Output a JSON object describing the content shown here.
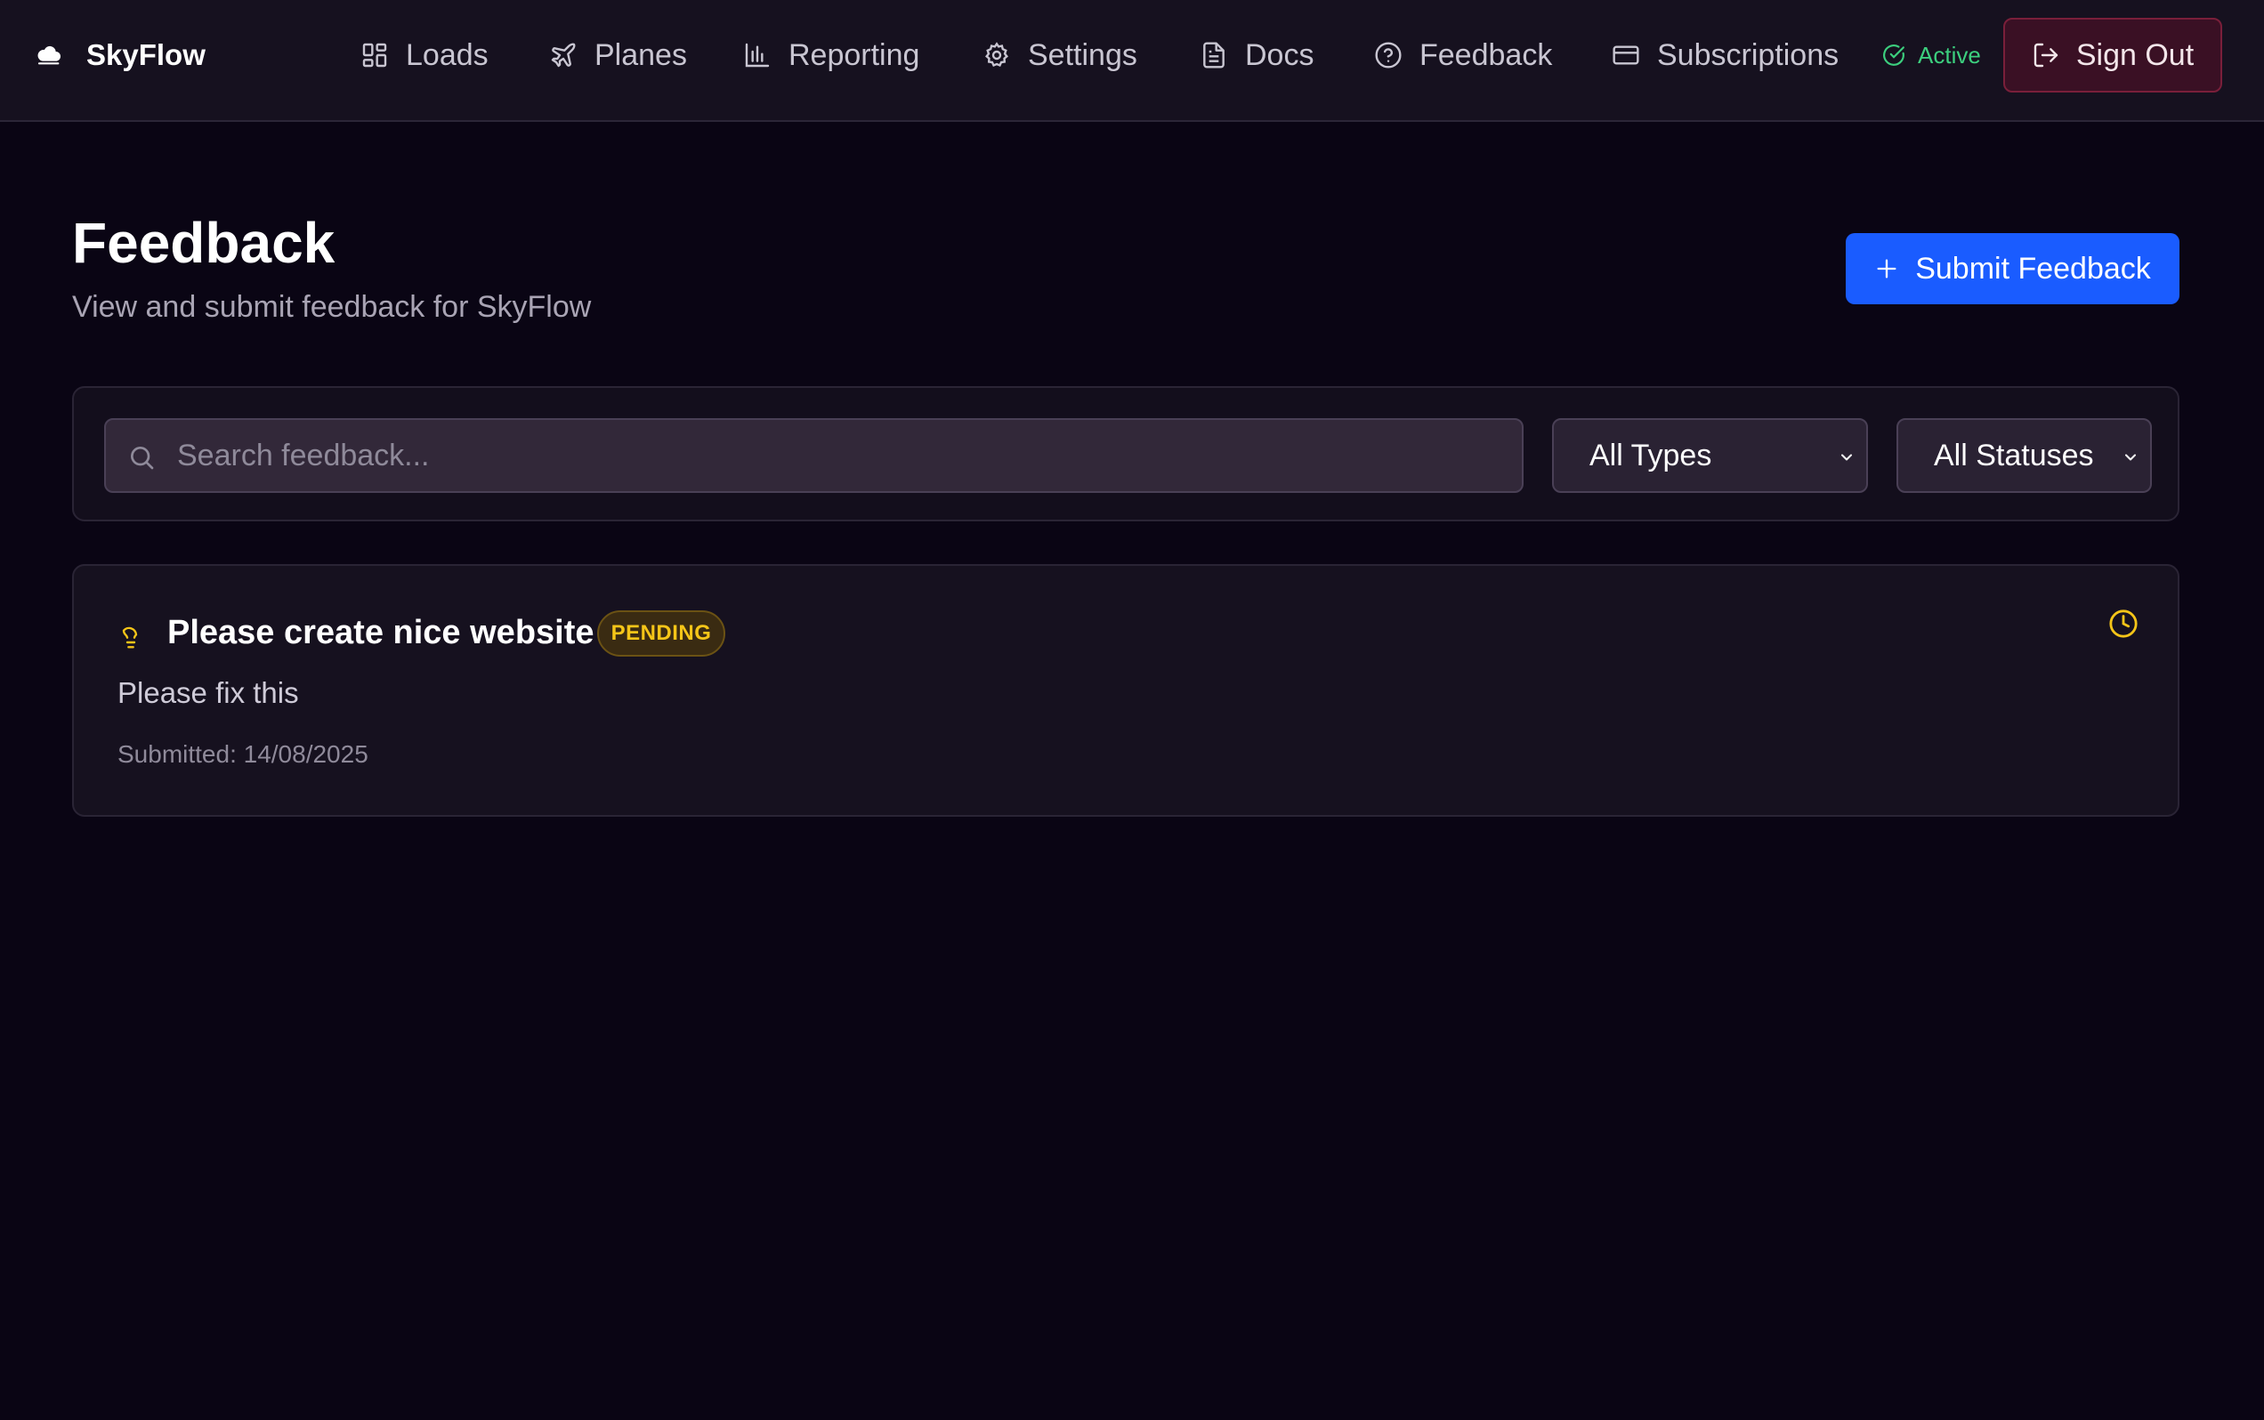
{
  "brand": {
    "name": "SkyFlow",
    "logo_icon": "cloud-logo-icon"
  },
  "nav": {
    "items": [
      {
        "label": "Loads",
        "icon": "grid-icon"
      },
      {
        "label": "Planes",
        "icon": "plane-icon"
      },
      {
        "label": "Reporting",
        "icon": "bar-chart-icon"
      },
      {
        "label": "Settings",
        "icon": "gear-icon"
      },
      {
        "label": "Docs",
        "icon": "document-icon"
      },
      {
        "label": "Feedback",
        "icon": "help-circle-icon"
      },
      {
        "label": "Subscriptions",
        "icon": "credit-card-icon"
      }
    ],
    "status_label": "Active",
    "sign_out_label": "Sign Out"
  },
  "header": {
    "title": "Feedback",
    "subtitle": "View and submit feedback for SkyFlow",
    "submit_label": "Submit Feedback"
  },
  "filters": {
    "search_placeholder": "Search feedback...",
    "type_selected": "All Types",
    "status_selected": "All Statuses"
  },
  "feedback": [
    {
      "title": "Please create nice website",
      "status": "PENDING",
      "description": "Please fix this",
      "submitted": "Submitted: 14/08/2025",
      "type_icon": "lightbulb-icon",
      "status_icon": "clock-icon"
    }
  ],
  "colors": {
    "background": "#0a0514",
    "topbar": "#16111f",
    "accent_blue": "#1a5cff",
    "active_green": "#3ccf7e",
    "pending_yellow": "#f5c518",
    "signout_bg": "#3a1024"
  }
}
